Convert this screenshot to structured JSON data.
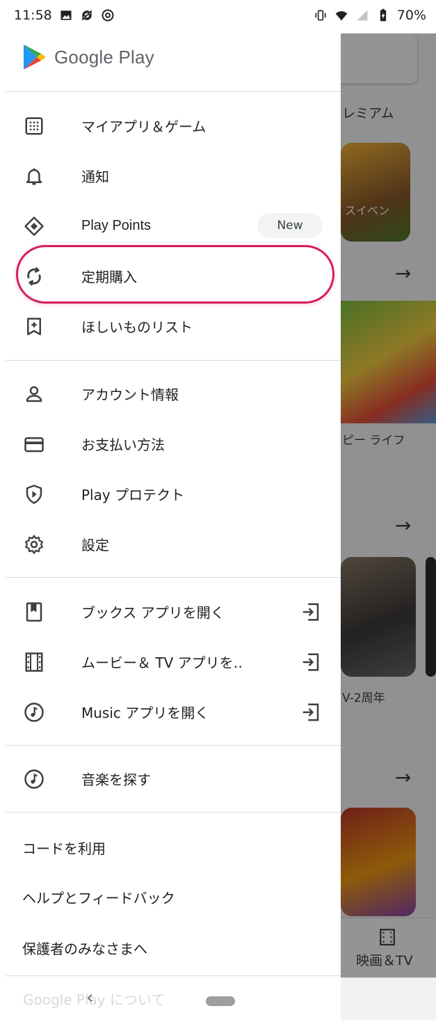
{
  "status": {
    "time": "11:58",
    "battery": "70%"
  },
  "brand": {
    "name": "Google Play"
  },
  "menu_group1": [
    {
      "label": "マイアプリ＆ゲーム",
      "icon": "grid-icon"
    },
    {
      "label": "通知",
      "icon": "bell-icon"
    },
    {
      "label": "Play Points",
      "icon": "diamond-icon",
      "badge": "New"
    },
    {
      "label": "定期購入",
      "icon": "refresh-icon"
    },
    {
      "label": "ほしいものリスト",
      "icon": "bookmark-add-icon"
    }
  ],
  "menu_group2": [
    {
      "label": "アカウント情報",
      "icon": "person-icon"
    },
    {
      "label": "お支払い方法",
      "icon": "credit-card-icon"
    },
    {
      "label": "Play プロテクト",
      "icon": "shield-play-icon"
    },
    {
      "label": "設定",
      "icon": "gear-icon"
    }
  ],
  "menu_group3": [
    {
      "label": "ブックス アプリを開く",
      "icon": "book-icon"
    },
    {
      "label": "ムービー＆ TV アプリを‥",
      "icon": "film-icon"
    },
    {
      "label": "Music アプリを開く",
      "icon": "music-note-icon"
    }
  ],
  "menu_group4": [
    {
      "label": "音楽を探す",
      "icon": "music-note-icon"
    }
  ],
  "text_items": [
    "コードを利用",
    "ヘルプとフィードバック",
    "保護者のみなさまへ"
  ],
  "footer_partial": "Google Play について",
  "background": {
    "chip_premium": "レミアム",
    "game_label": "ピー ライフ",
    "app_label": "V-2周年",
    "nav_movies": "映画＆TV",
    "tile_text": "スイベン"
  },
  "colors": {
    "highlight": "#d81b60",
    "accent_green": "#01875f"
  }
}
